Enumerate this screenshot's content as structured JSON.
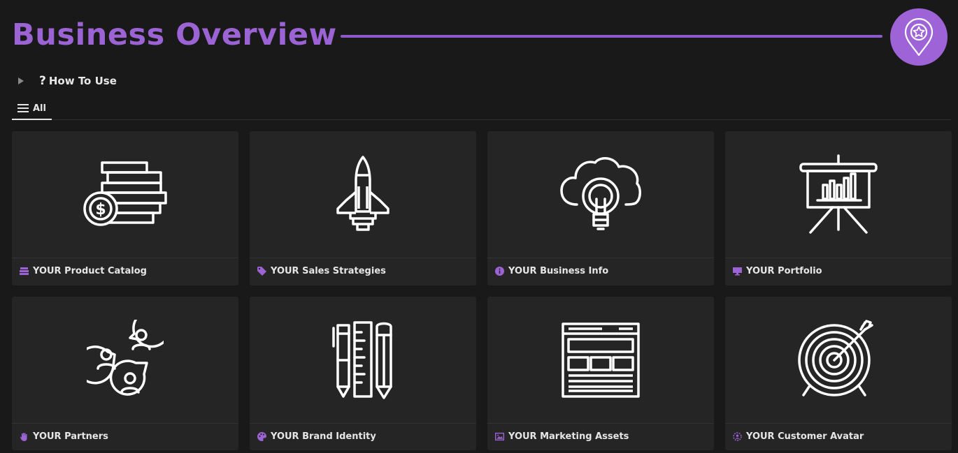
{
  "header": {
    "title": "Business Overview",
    "accent_color": "#9b63d3",
    "badge_icon": "location-star-pin-icon"
  },
  "toggle": {
    "icon": "question-mark",
    "label": "How To Use"
  },
  "tabs": [
    {
      "label": "All",
      "icon": "list-icon",
      "active": true
    }
  ],
  "cards": [
    {
      "title": "YOUR Product Catalog",
      "footer_icon": "stack-icon",
      "cover_icon": "coin-stack-icon"
    },
    {
      "title": "YOUR Sales Strategies",
      "footer_icon": "tag-icon",
      "cover_icon": "rocket-icon"
    },
    {
      "title": "YOUR Business Info",
      "footer_icon": "info-icon",
      "cover_icon": "cloud-lightbulb-icon"
    },
    {
      "title": "YOUR Portfolio",
      "footer_icon": "monitor-icon",
      "cover_icon": "presentation-chart-icon"
    },
    {
      "title": "YOUR Partners",
      "footer_icon": "hand-icon",
      "cover_icon": "people-chat-icon"
    },
    {
      "title": "YOUR Brand Identity",
      "footer_icon": "palette-icon",
      "cover_icon": "pens-ruler-icon"
    },
    {
      "title": "YOUR Marketing Assets",
      "footer_icon": "image-icon",
      "cover_icon": "webpage-layout-icon"
    },
    {
      "title": "YOUR Customer Avatar",
      "footer_icon": "target-avatar-icon",
      "cover_icon": "target-arrow-icon"
    }
  ]
}
